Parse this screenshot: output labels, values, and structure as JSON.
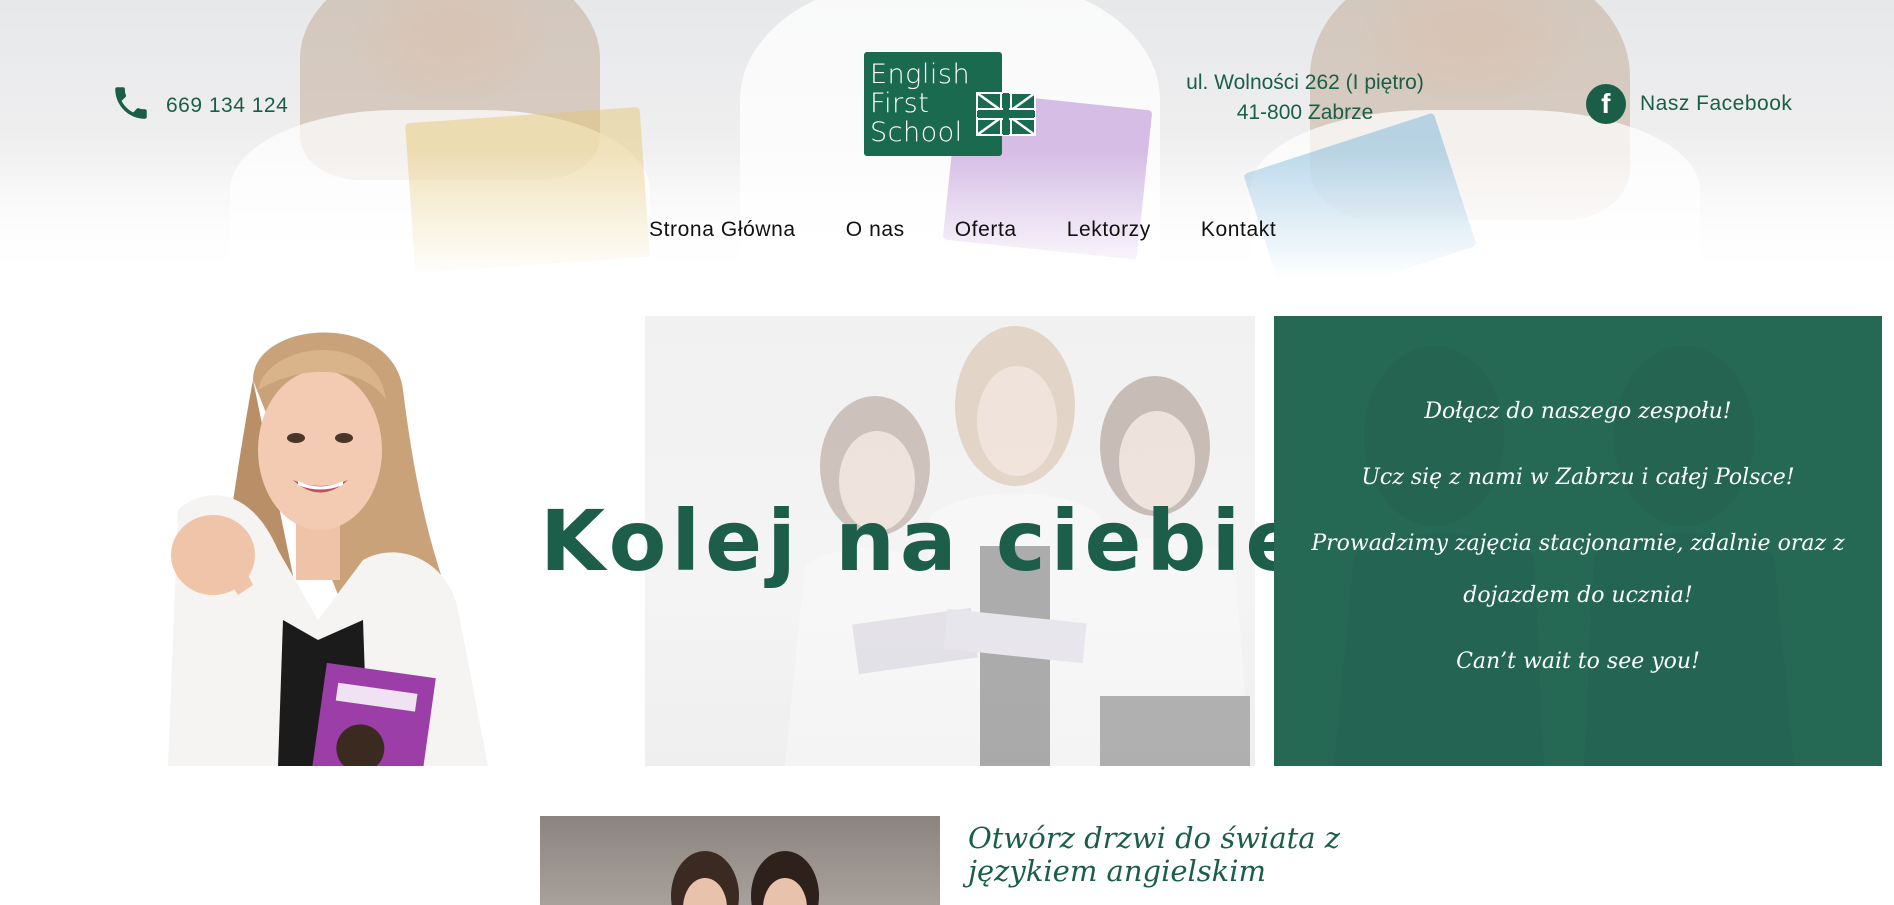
{
  "header": {
    "phone": "669 134 124",
    "address_line1": "ul. Wolności 262 (I piętro)",
    "address_line2": "41-800 Zabrze",
    "facebook_label": "Nasz Facebook",
    "facebook_icon_glyph": "f"
  },
  "logo": {
    "line1": "English",
    "line2": "First",
    "line3": "School"
  },
  "nav": {
    "items": [
      "Strona Główna",
      "O nas",
      "Oferta",
      "Lektorzy",
      "Kontakt"
    ]
  },
  "hero": {
    "title": "Kolej na ciebie!"
  },
  "panel": {
    "line1": "Dołącz do naszego zespołu!",
    "line2": "Ucz się z nami w Zabrzu i całej Polsce!",
    "line3": "Prowadzimy zajęcia stacjonarnie, zdalnie oraz z dojazdem do ucznia!",
    "line4": "Can’t wait to see you!"
  },
  "section2": {
    "title": "Otwórz drzwi do świata z językiem angielskim"
  },
  "colors": {
    "brand_green": "#1a5e48",
    "panel_green": "#2b6b57"
  }
}
